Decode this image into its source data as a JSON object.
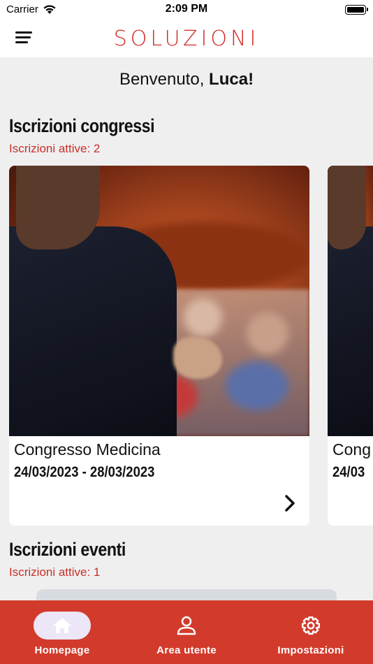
{
  "status_bar": {
    "carrier": "Carrier",
    "time": "2:09 PM"
  },
  "header": {
    "logo_text": "SOLUZIONI",
    "menu_icon": "hamburger-menu-icon"
  },
  "welcome": {
    "greeting": "Benvenuto,",
    "name": "Luca!"
  },
  "congress_section": {
    "title": "Iscrizioni congressi",
    "subtitle": "Iscrizioni attive: 2",
    "cards": [
      {
        "title": "Congresso Medicina",
        "dates": "24/03/2023 - 28/03/2023"
      },
      {
        "title": "Cong",
        "dates": "24/03"
      }
    ]
  },
  "events_section": {
    "title": "Iscrizioni eventi",
    "subtitle": "Iscrizioni attive: 1"
  },
  "tabs": [
    {
      "label": "Homepage",
      "icon": "home-icon",
      "active": true
    },
    {
      "label": "Area utente",
      "icon": "user-icon",
      "active": false
    },
    {
      "label": "Impostazioni",
      "icon": "gear-icon",
      "active": false
    }
  ],
  "colors": {
    "accent": "#d23b2b",
    "subtitle": "#c7302b",
    "active_pill": "#ece6f7"
  }
}
